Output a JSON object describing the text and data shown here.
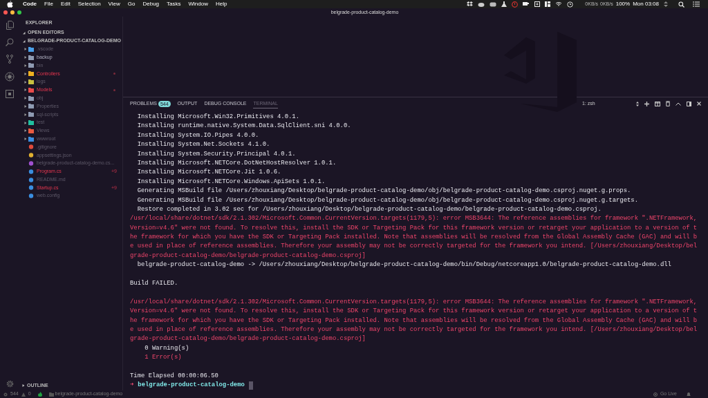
{
  "menu_bar": {
    "items": [
      "Code",
      "File",
      "Edit",
      "Selection",
      "View",
      "Go",
      "Debug",
      "Tasks",
      "Window",
      "Help"
    ],
    "net_up": "0KB/s",
    "net_down": "0KB/s",
    "battery": "100%",
    "clock": "Mon 03:08"
  },
  "window": {
    "title": "belgrade-product-catalog-demo"
  },
  "sidebar": {
    "title": "EXPLORER",
    "sections": [
      {
        "label": "OPEN EDITORS",
        "expanded": true
      },
      {
        "label": "BELGRADE-PRODUCT-CATALOG-DEMO",
        "expanded": true
      }
    ],
    "items": [
      {
        "kind": "folder",
        "name": ".vscode",
        "color": "#4a9fe8",
        "modified": false,
        "ignored": true
      },
      {
        "kind": "folder",
        "name": "backup",
        "color": "#8f9bb3",
        "modified": false,
        "ignored": false
      },
      {
        "kind": "folder",
        "name": "bin",
        "color": "#8f9bb3",
        "modified": false,
        "ignored": true
      },
      {
        "kind": "folder",
        "name": "Controllers",
        "color": "#f0b020",
        "modified": true,
        "ignored": false
      },
      {
        "kind": "folder",
        "name": "logs",
        "color": "#c8c040",
        "modified": false,
        "ignored": true
      },
      {
        "kind": "folder",
        "name": "Models",
        "color": "#e84a4a",
        "modified": true,
        "ignored": false
      },
      {
        "kind": "folder",
        "name": "obj",
        "color": "#8f9bb3",
        "modified": false,
        "ignored": true
      },
      {
        "kind": "folder",
        "name": "Properties",
        "color": "#8f9bb3",
        "modified": false,
        "ignored": true
      },
      {
        "kind": "folder",
        "name": "sql-scripts",
        "color": "#8f9bb3",
        "modified": false,
        "ignored": true
      },
      {
        "kind": "folder",
        "name": "test",
        "color": "#20c0a0",
        "modified": false,
        "ignored": true
      },
      {
        "kind": "folder",
        "name": "Views",
        "color": "#e85a40",
        "modified": false,
        "ignored": true
      },
      {
        "kind": "folder",
        "name": "wwwroot",
        "color": "#3a8ee0",
        "modified": false,
        "ignored": true
      },
      {
        "kind": "file",
        "name": ".gitignore",
        "color": "#e04a3a",
        "modified": false,
        "ignored": true
      },
      {
        "kind": "file",
        "name": "appsettings.json",
        "color": "#e0b030",
        "modified": false,
        "ignored": true
      },
      {
        "kind": "file",
        "name": "belgrade-product-catalog-demo.cs...",
        "color": "#a050d0",
        "modified": false,
        "ignored": true
      },
      {
        "kind": "file",
        "name": "Program.cs",
        "color": "#3a8ee0",
        "modified": true,
        "ignored": false,
        "badge": "+9"
      },
      {
        "kind": "file",
        "name": "README.md",
        "color": "#3a8ee0",
        "modified": false,
        "ignored": true
      },
      {
        "kind": "file",
        "name": "Startup.cs",
        "color": "#3a8ee0",
        "modified": true,
        "ignored": false,
        "badge": "+9"
      },
      {
        "kind": "file",
        "name": "web.config",
        "color": "#3a8ee0",
        "modified": false,
        "ignored": true
      }
    ],
    "outline": {
      "label": "OUTLINE",
      "expanded": false
    }
  },
  "panel": {
    "tabs": [
      {
        "label": "PROBLEMS",
        "badge": "544",
        "selected": false
      },
      {
        "label": "OUTPUT",
        "selected": false
      },
      {
        "label": "DEBUG CONSOLE",
        "selected": false
      },
      {
        "label": "TERMINAL",
        "selected": true
      }
    ],
    "terminal_select": "1: zsh",
    "lines": [
      {
        "kind": "normal",
        "text": "  Installing Microsoft.Win32.Primitives 4.0.1."
      },
      {
        "kind": "normal",
        "text": "  Installing runtime.native.System.Data.SqlClient.sni 4.0.0."
      },
      {
        "kind": "normal",
        "text": "  Installing System.IO.Pipes 4.0.0."
      },
      {
        "kind": "normal",
        "text": "  Installing System.Net.Sockets 4.1.0."
      },
      {
        "kind": "normal",
        "text": "  Installing System.Security.Principal 4.0.1."
      },
      {
        "kind": "normal",
        "text": "  Installing Microsoft.NETCore.DotNetHostResolver 1.0.1."
      },
      {
        "kind": "normal",
        "text": "  Installing Microsoft.NETCore.Jit 1.0.6."
      },
      {
        "kind": "normal",
        "text": "  Installing Microsoft.NETCore.Windows.ApiSets 1.0.1."
      },
      {
        "kind": "normal",
        "text": "  Generating MSBuild file /Users/zhouxiang/Desktop/belgrade-product-catalog-demo/obj/belgrade-product-catalog-demo.csproj.nuget.g.props."
      },
      {
        "kind": "normal",
        "text": "  Generating MSBuild file /Users/zhouxiang/Desktop/belgrade-product-catalog-demo/obj/belgrade-product-catalog-demo.csproj.nuget.g.targets."
      },
      {
        "kind": "normal",
        "text": "  Restore completed in 3.02 sec for /Users/zhouxiang/Desktop/belgrade-product-catalog-demo/belgrade-product-catalog-demo.csproj."
      },
      {
        "kind": "error",
        "text": "/usr/local/share/dotnet/sdk/2.1.302/Microsoft.Common.CurrentVersion.targets(1179,5): error MSB3644: The reference assemblies for framework \".NETFramework,"
      },
      {
        "kind": "error",
        "text": "Version=v4.6\" were not found. To resolve this, install the SDK or Targeting Pack for this framework version or retarget your application to a version of t"
      },
      {
        "kind": "error",
        "text": "he framework for which you have the SDK or Targeting Pack installed. Note that assemblies will be resolved from the Global Assembly Cache (GAC) and will b"
      },
      {
        "kind": "error",
        "text": "e used in place of reference assemblies. Therefore your assembly may not be correctly targeted for the framework you intend. [/Users/zhouxiang/Desktop/bel"
      },
      {
        "kind": "error",
        "text": "grade-product-catalog-demo/belgrade-product-catalog-demo.csproj]"
      },
      {
        "kind": "normal",
        "text": "  belgrade-product-catalog-demo -> /Users/zhouxiang/Desktop/belgrade-product-catalog-demo/bin/Debug/netcoreapp1.0/belgrade-product-catalog-demo.dll"
      },
      {
        "kind": "blank"
      },
      {
        "kind": "normal",
        "text": "Build FAILED."
      },
      {
        "kind": "blank"
      },
      {
        "kind": "error",
        "text": "/usr/local/share/dotnet/sdk/2.1.302/Microsoft.Common.CurrentVersion.targets(1179,5): error MSB3644: The reference assemblies for framework \".NETFramework,"
      },
      {
        "kind": "error",
        "text": "Version=v4.6\" were not found. To resolve this, install the SDK or Targeting Pack for this framework version or retarget your application to a version of t"
      },
      {
        "kind": "error",
        "text": "he framework for which you have the SDK or Targeting Pack installed. Note that assemblies will be resolved from the Global Assembly Cache (GAC) and will b"
      },
      {
        "kind": "error",
        "text": "e used in place of reference assemblies. Therefore your assembly may not be correctly targeted for the framework you intend. [/Users/zhouxiang/Desktop/bel"
      },
      {
        "kind": "error",
        "text": "grade-product-catalog-demo/belgrade-product-catalog-demo.csproj]"
      },
      {
        "kind": "normal",
        "text": "    0 Warning(s)"
      },
      {
        "kind": "error",
        "text": "    1 Error(s)"
      },
      {
        "kind": "blank"
      },
      {
        "kind": "normal",
        "text": "Time Elapsed 00:00:06.50"
      },
      {
        "kind": "prompt",
        "arrow": "➜",
        "text": "belgrade-product-catalog-demo"
      }
    ]
  },
  "status_bar": {
    "errors": "544",
    "warnings": "0",
    "folder": "belgrade-product-catalog-demo",
    "go_live": "Go Live"
  }
}
